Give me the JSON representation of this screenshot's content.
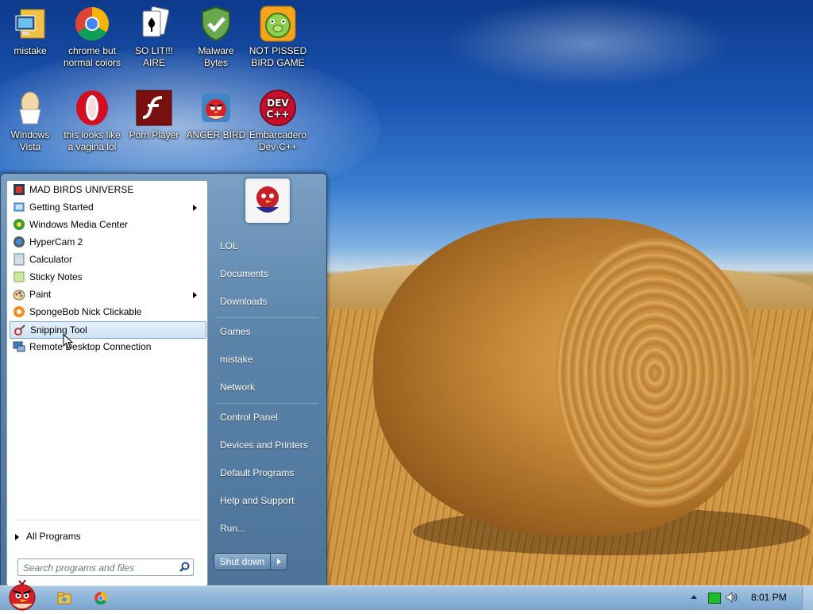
{
  "desktop_icons": [
    {
      "label": "mistake",
      "icon": "monitor-folder-icon"
    },
    {
      "label": "chrome but normal colors",
      "icon": "chrome-icon"
    },
    {
      "label": "SO LIT!!! AIRE",
      "icon": "solitaire-cards-icon"
    },
    {
      "label": "Malware Bytes",
      "icon": "shield-check-icon"
    },
    {
      "label": "NOT PISSED BIRD GAME",
      "icon": "green-pig-icon"
    },
    {
      "label": "Windows Vista",
      "icon": "egg-cup-icon"
    },
    {
      "label": "this looks like a vagina lol",
      "icon": "opera-icon"
    },
    {
      "label": "Porn Player",
      "icon": "flash-player-icon"
    },
    {
      "label": "ANGER BIRD",
      "icon": "angry-bird-icon"
    },
    {
      "label": "Embarcadero Dev-C++",
      "icon": "devcpp-icon"
    }
  ],
  "start_menu": {
    "programs": [
      {
        "label": "MAD BIRDS UNIVERSE",
        "icon": "game-icon",
        "submenu": false
      },
      {
        "label": "Getting Started",
        "icon": "getting-started-icon",
        "submenu": true
      },
      {
        "label": "Windows Media Center",
        "icon": "media-center-icon",
        "submenu": false
      },
      {
        "label": "HyperCam 2",
        "icon": "hypercam-icon",
        "submenu": false
      },
      {
        "label": "Calculator",
        "icon": "calculator-icon",
        "submenu": false
      },
      {
        "label": "Sticky Notes",
        "icon": "sticky-notes-icon",
        "submenu": false
      },
      {
        "label": "Paint",
        "icon": "paint-icon",
        "submenu": true
      },
      {
        "label": "SpongeBob Nick Clickable",
        "icon": "spongebob-icon",
        "submenu": false
      },
      {
        "label": "Snipping Tool",
        "icon": "snipping-tool-icon",
        "submenu": false,
        "selected": true
      },
      {
        "label": "Remote Desktop Connection",
        "icon": "remote-desktop-icon",
        "submenu": false
      }
    ],
    "all_programs": "All Programs",
    "search_placeholder": "Search programs and files",
    "right_pane": {
      "group1": [
        "LOL",
        "Documents",
        "Downloads"
      ],
      "group2": [
        "Games",
        "mistake",
        "Network"
      ],
      "group3": [
        "Control Panel",
        "Devices and Printers",
        "Default Programs",
        "Help and Support",
        "Run..."
      ]
    },
    "shutdown_label": "Shut down"
  },
  "taskbar": {
    "clock": "8:01 PM"
  },
  "colors": {
    "accent": "#7da2ce",
    "tray_network": "#1dbb2a"
  }
}
